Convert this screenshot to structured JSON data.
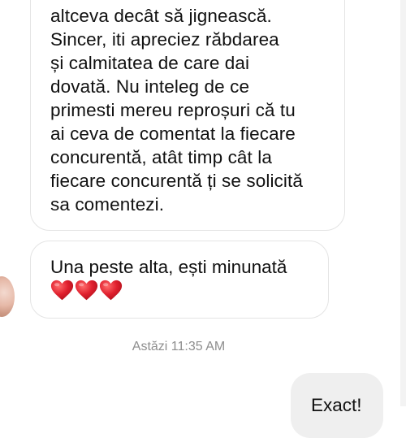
{
  "conversation": {
    "messages": [
      {
        "sender": "other",
        "lines": [
          "altceva decât să jignească.",
          "Sincer, iti apreciez răbdarea",
          "și calmitatea de care dai",
          "dovată. Nu inteleg de ce",
          "primesti mereu reproșuri că tu",
          "ai ceva de comentat la fiecare",
          "concurentă, atât timp cât la",
          "fiecare concurentă ți se solicită",
          "sa comentezi."
        ]
      },
      {
        "sender": "other",
        "text": "Una peste alta, ești minunată",
        "emoji": "❤️❤️❤️"
      }
    ],
    "timestamp": "Astăzi 11:35 AM",
    "outgoing": {
      "sender": "me",
      "text": "Exact!"
    }
  },
  "colors": {
    "incoming_bubble": "#ffffff",
    "incoming_border": "#e4e4e4",
    "outgoing_bubble": "#efefef",
    "timestamp": "#8e8e8e",
    "heart": "#e0202e"
  },
  "icons": {
    "heart": "heart-icon"
  }
}
